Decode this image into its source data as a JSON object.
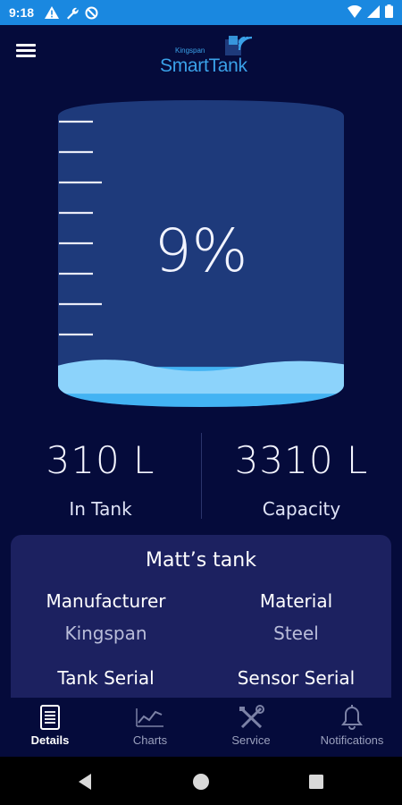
{
  "status_bar": {
    "time": "9:18",
    "left_icons": [
      "warning-icon",
      "wrench-icon",
      "no-sync-icon"
    ],
    "right_icons": [
      "wifi-icon",
      "cellular-icon",
      "battery-icon"
    ],
    "background_color": "#1a88e0"
  },
  "header": {
    "logo_small": "Kingspan",
    "logo_main": "SmartTank",
    "menu_icon": "hamburger-menu-icon"
  },
  "tank": {
    "fill_percent_label": "9%",
    "fill_level": 0.09,
    "liquid_color": "#43b3f3"
  },
  "stats": {
    "in_tank_value": "310 L",
    "in_tank_label": "In Tank",
    "capacity_value": "3310 L",
    "capacity_label": "Capacity"
  },
  "card": {
    "title": "Matt’s tank",
    "manufacturer_label": "Manufacturer",
    "manufacturer_value": "Kingspan",
    "material_label": "Material",
    "material_value": "Steel",
    "tank_serial_label": "Tank Serial",
    "sensor_serial_label": "Sensor Serial"
  },
  "nav": {
    "items": [
      {
        "label": "Details",
        "icon": "details-icon",
        "active": true
      },
      {
        "label": "Charts",
        "icon": "chart-icon",
        "active": false
      },
      {
        "label": "Service",
        "icon": "tools-icon",
        "active": false
      },
      {
        "label": "Notifications",
        "icon": "bell-icon",
        "active": false
      }
    ]
  },
  "colors": {
    "background": "#050b3b",
    "card": "#1c2160",
    "tank_body": "#1e3a7b",
    "accent": "#3aa1e8"
  }
}
